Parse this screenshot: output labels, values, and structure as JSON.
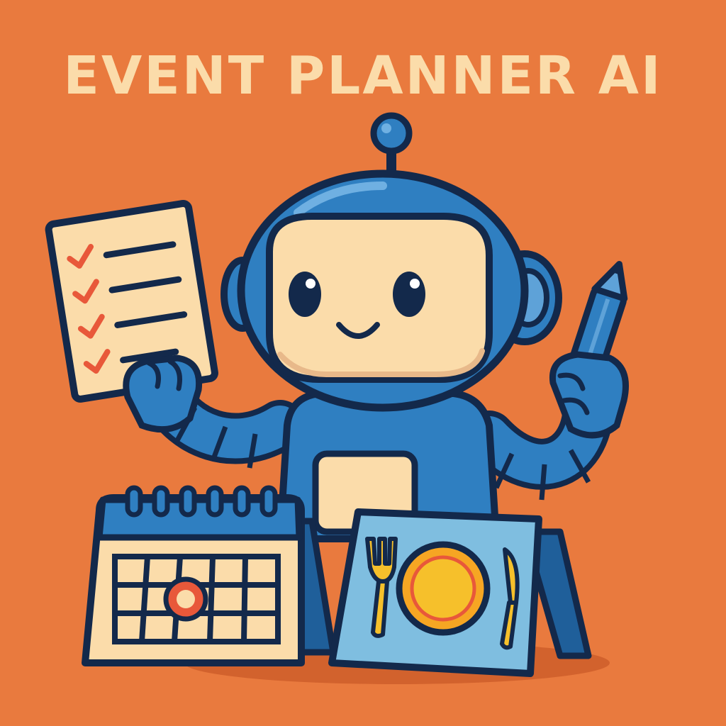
{
  "title": "EVENT PLANNER AI",
  "colors": {
    "background": "#e97a3e",
    "title_text": "#fbdcaa",
    "robot_blue": "#2f7fc1",
    "robot_highlight": "#5ea2d8",
    "outline": "#13294b",
    "face": "#fbdcaa",
    "checkmark": "#e8583a",
    "plate": "#f6a623",
    "placemat": "#7fbee0",
    "calendar_highlight": "#e8583a"
  },
  "icons": {
    "robot": "robot-mascot",
    "checklist": "checklist-icon",
    "pencil": "pencil-icon",
    "calendar": "calendar-icon",
    "place_setting": "place-setting-icon"
  }
}
